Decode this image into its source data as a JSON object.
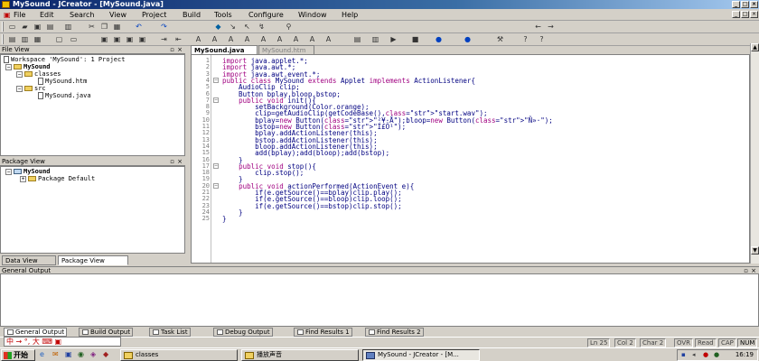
{
  "window": {
    "title": "MySound - JCreator - [MySound.java]"
  },
  "menu": {
    "items": [
      "File",
      "Edit",
      "Search",
      "View",
      "Project",
      "Build",
      "Tools",
      "Configure",
      "Window",
      "Help"
    ]
  },
  "file_view": {
    "title": "File View",
    "workspace": "Workspace 'MySound': 1 Project",
    "project": "MySound",
    "folder_classes": "classes",
    "file_htm": "MySound.htm",
    "folder_src": "src",
    "file_java": "MySound.java"
  },
  "package_view": {
    "title": "Package View",
    "project": "MySound",
    "package": "Package Default"
  },
  "left_tabs": {
    "data_view": "Data View",
    "package_view": "Package View"
  },
  "editor": {
    "tabs": [
      "MySound.java",
      "MySound.htm"
    ],
    "lines": [
      "import java.applet.*;",
      "import java.awt.*;",
      "import java.awt.event.*;",
      "public class MySound extends Applet implements ActionListener{",
      "    AudioClip clip;",
      "    Button bplay,bloop,bstop;",
      "    public void init(){",
      "        setBackground(Color.orange);",
      "        clip=getAudioClip(getCodeBase(),\"start.wav\");",
      "        bplay=new Button(\"²¥·Å\");bloop=new Button(\"Ñ­»·\");",
      "        bstop=new Button(\"Í£Ö¹\");",
      "        bplay.addActionListener(this);",
      "        bstop.addActionListener(this);",
      "        bloop.addActionListener(this);",
      "        add(bplay);add(bloop);add(bstop);",
      "    }",
      "    public void stop(){",
      "        clip.stop();",
      "    }",
      "    public void actionPerformed(ActionEvent e){",
      "        if(e.getSource()==bplay)clip.play();",
      "        if(e.getSource()==bloop)clip.loop();",
      "        if(e.getSource()==bstop)clip.stop();",
      "    }",
      "}"
    ]
  },
  "output": {
    "title": "General Output",
    "tabs": [
      "General Output",
      "Build Output",
      "Task List",
      "Debug Output",
      "Find Results 1",
      "Find Results 2"
    ]
  },
  "ime": {
    "text": "中 → °, 大 ⌨ ▣"
  },
  "statusbar": {
    "ln": "Ln 25",
    "col": "Col 2",
    "char": "Char 2",
    "ovr": "OVR",
    "read": "Read",
    "cap": "CAP",
    "num": "NUM"
  },
  "taskbar": {
    "start": "开始",
    "tasks": [
      "classes",
      "播放声音",
      "MySound - JCreator - [M..."
    ],
    "clock": "16:19"
  }
}
